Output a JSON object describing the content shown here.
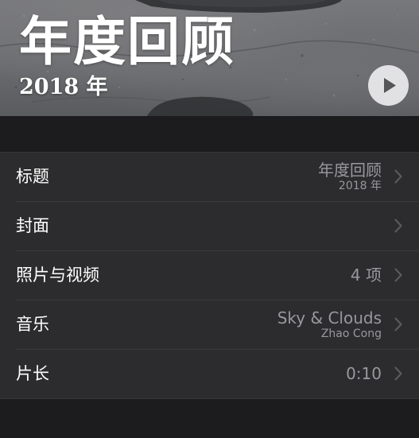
{
  "hero": {
    "title": "年度回顾",
    "subtitle": "2018 年",
    "play_icon": "play-icon"
  },
  "settings": [
    {
      "label": "标题",
      "value": "年度回顾",
      "sub": "2018 年"
    },
    {
      "label": "封面",
      "value": "",
      "sub": ""
    },
    {
      "label": "照片与视频",
      "value": "4 项",
      "sub": ""
    },
    {
      "label": "音乐",
      "value": "Sky & Clouds",
      "sub": "Zhao Cong"
    },
    {
      "label": "片长",
      "value": "0:10",
      "sub": ""
    }
  ],
  "icons": {
    "chevron": "chevron-right-icon"
  },
  "colors": {
    "background": "#1c1c1e",
    "row_background": "#2c2c2e",
    "secondary_text": "#98989d",
    "chevron": "#5a5a5e"
  }
}
